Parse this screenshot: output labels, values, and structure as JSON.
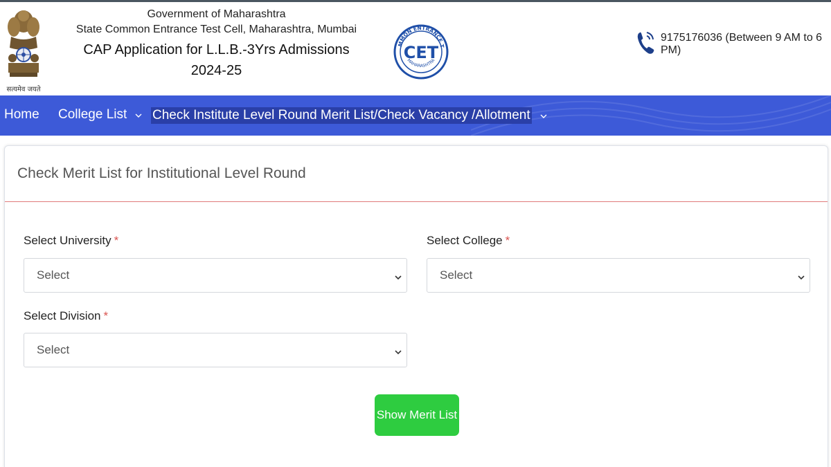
{
  "header": {
    "line1": "Government of Maharashtra",
    "line2": "State Common Entrance Test Cell, Maharashtra, Mumbai",
    "line3": "CAP Application for L.L.B.-3Yrs Admissions 2024-25",
    "emblem_motto": "सत्यमेव जयते",
    "logo_text": "CET",
    "logo_ring_text": "STATE COMMON ENTRANCE TEST CELL",
    "logo_bottom_text": "MAHARASHTRA",
    "contact": "9175176036 (Between 9 AM to 6 PM)"
  },
  "nav": {
    "home": "Home",
    "college_list": "College List",
    "check": "Check Institute Level Round Merit List/Check Vacancy /Allotment"
  },
  "form": {
    "title": "Check Merit List for Institutional Level Round",
    "university_label": "Select University",
    "college_label": "Select College",
    "division_label": "Select Division",
    "required_mark": "*",
    "university_value": "Select",
    "college_value": "Select",
    "division_value": "Select",
    "submit_label": "Show Merit List"
  },
  "colors": {
    "nav_bg": "#3d5ad8",
    "button_bg": "#2ecc40",
    "required": "#d9534f",
    "logo_blue": "#1f4fa8"
  },
  "icons": {
    "phone": "phone-icon",
    "chevron": "chevron-down-icon",
    "emblem": "state-emblem-icon"
  }
}
